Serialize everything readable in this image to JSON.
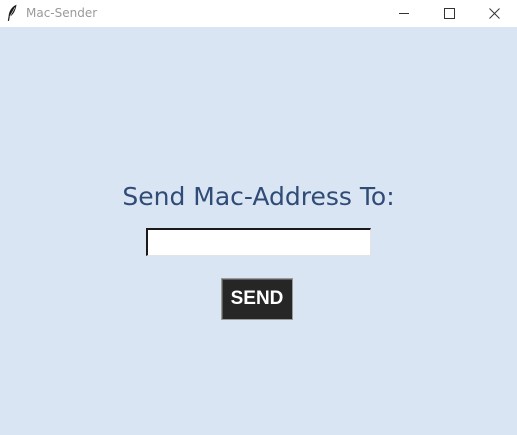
{
  "window": {
    "title": "Mac-Sender",
    "icon": "feather-icon",
    "controls": {
      "minimize_icon": "minimize-icon",
      "maximize_icon": "maximize-icon",
      "close_icon": "close-icon"
    }
  },
  "main": {
    "heading": "Send Mac-Address To:",
    "input_value": "",
    "send_label": "SEND"
  },
  "colors": {
    "background": "#dae5f3",
    "heading": "#2f4b76",
    "button_bg": "#262626",
    "button_text": "#ffffff"
  }
}
